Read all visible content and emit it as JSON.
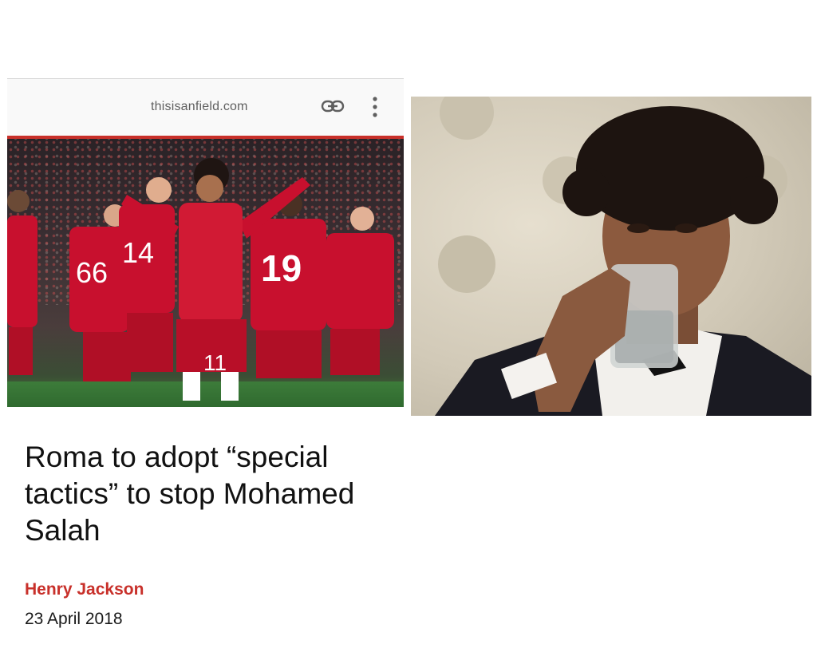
{
  "article": {
    "site": "thisisanfield.com",
    "headline": "Roma to adopt “special tactics” to stop Mohamed Salah",
    "author": "Henry Jackson",
    "date": "23 April 2018"
  },
  "photo": {
    "jersey_numbers": [
      "66",
      "14",
      "11",
      "19"
    ]
  },
  "icons": {
    "link": "link-icon",
    "menu": "more-vertical-icon"
  },
  "colors": {
    "accent": "#c8302a",
    "kit_red": "#c8102e"
  }
}
